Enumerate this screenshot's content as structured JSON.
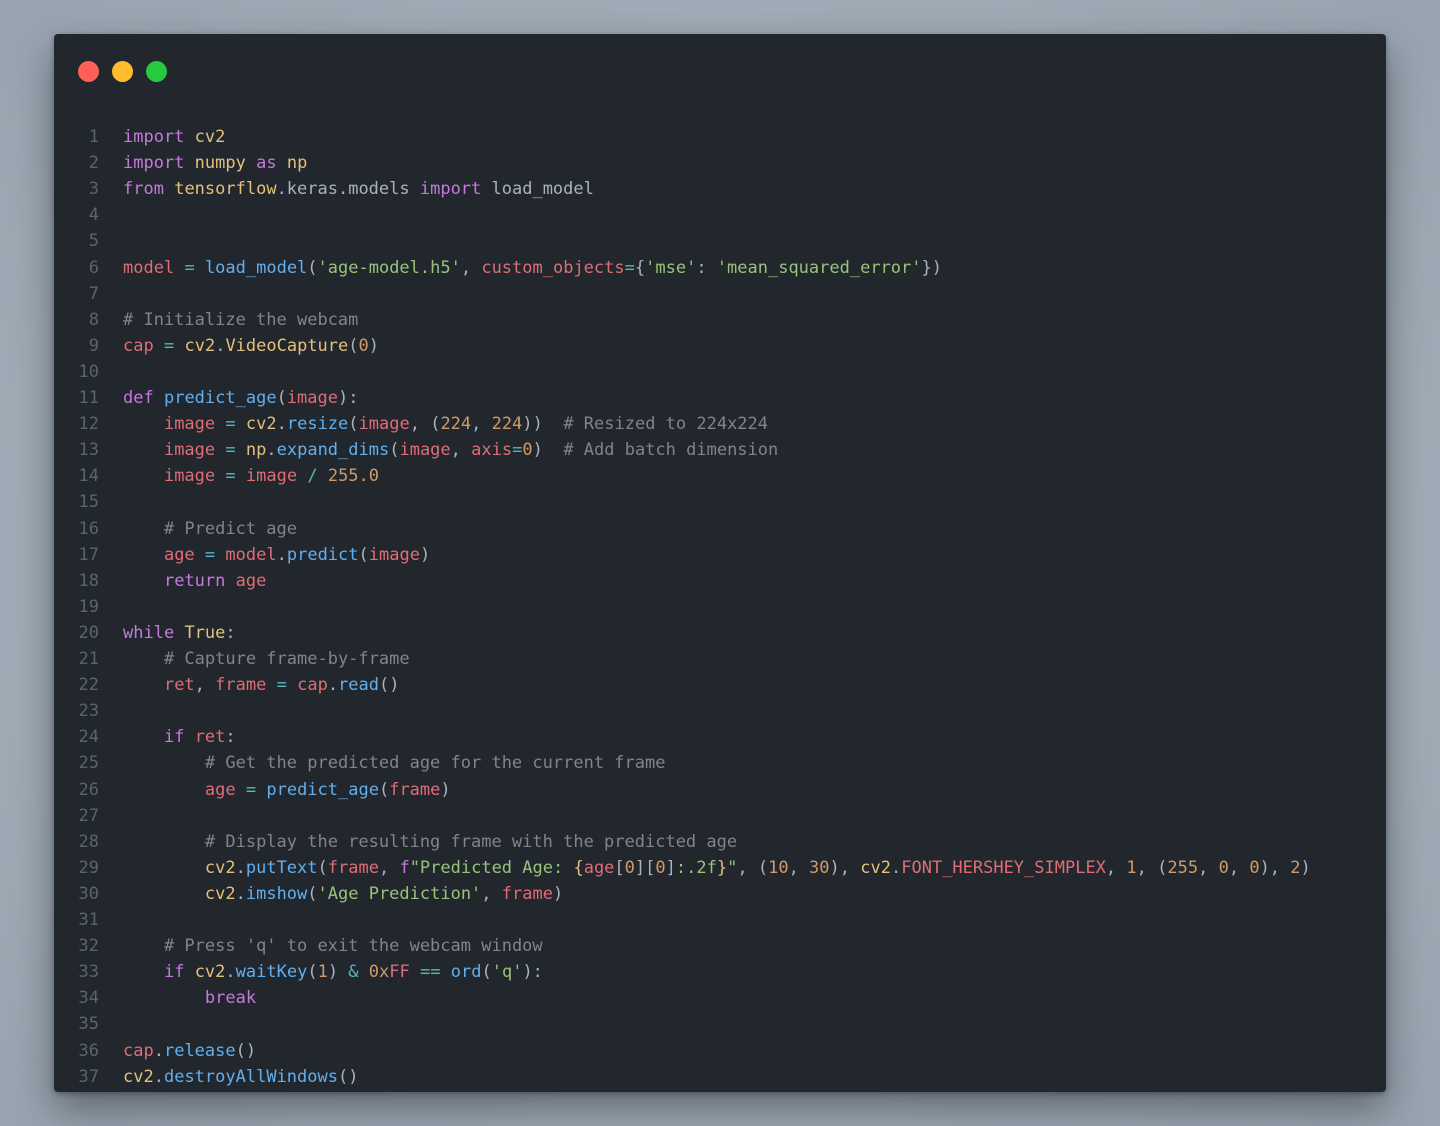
{
  "window": {
    "controls": [
      {
        "name": "close",
        "color": "#ff5f56"
      },
      {
        "name": "minimize",
        "color": "#ffbd2e"
      },
      {
        "name": "maximize",
        "color": "#27c93f"
      }
    ]
  },
  "code": {
    "language": "python",
    "lines": [
      [
        [
          "kw",
          "import"
        ],
        [
          "pl",
          " "
        ],
        [
          "mod",
          "cv2"
        ]
      ],
      [
        [
          "kw",
          "import"
        ],
        [
          "pl",
          " "
        ],
        [
          "mod",
          "numpy"
        ],
        [
          "pl",
          " "
        ],
        [
          "kw",
          "as"
        ],
        [
          "pl",
          " "
        ],
        [
          "mod",
          "np"
        ]
      ],
      [
        [
          "kw",
          "from"
        ],
        [
          "pl",
          " "
        ],
        [
          "mod",
          "tensorflow"
        ],
        [
          "pl",
          ".keras.models "
        ],
        [
          "kw",
          "import"
        ],
        [
          "pl",
          " load_model"
        ]
      ],
      [],
      [],
      [
        [
          "var",
          "model"
        ],
        [
          "pl",
          " "
        ],
        [
          "op",
          "="
        ],
        [
          "pl",
          " "
        ],
        [
          "fn",
          "load_model"
        ],
        [
          "pl",
          "("
        ],
        [
          "str",
          "'age-model.h5'"
        ],
        [
          "pl",
          ", "
        ],
        [
          "var",
          "custom_objects"
        ],
        [
          "op",
          "="
        ],
        [
          "pl",
          "{"
        ],
        [
          "str",
          "'mse'"
        ],
        [
          "pl",
          ": "
        ],
        [
          "str",
          "'mean_squared_error'"
        ],
        [
          "pl",
          "})"
        ]
      ],
      [],
      [
        [
          "cm",
          "# Initialize the webcam"
        ]
      ],
      [
        [
          "var",
          "cap"
        ],
        [
          "pl",
          " "
        ],
        [
          "op",
          "="
        ],
        [
          "pl",
          " "
        ],
        [
          "mod",
          "cv2"
        ],
        [
          "pl",
          "."
        ],
        [
          "mod",
          "VideoCapture"
        ],
        [
          "pl",
          "("
        ],
        [
          "num",
          "0"
        ],
        [
          "pl",
          ")"
        ]
      ],
      [],
      [
        [
          "kw",
          "def"
        ],
        [
          "pl",
          " "
        ],
        [
          "fn",
          "predict_age"
        ],
        [
          "pl",
          "("
        ],
        [
          "var",
          "image"
        ],
        [
          "pl",
          "):"
        ]
      ],
      [
        [
          "pl",
          "    "
        ],
        [
          "var",
          "image"
        ],
        [
          "pl",
          " "
        ],
        [
          "op",
          "="
        ],
        [
          "pl",
          " "
        ],
        [
          "mod",
          "cv2"
        ],
        [
          "pl",
          "."
        ],
        [
          "fn",
          "resize"
        ],
        [
          "pl",
          "("
        ],
        [
          "var",
          "image"
        ],
        [
          "pl",
          ", ("
        ],
        [
          "num",
          "224"
        ],
        [
          "pl",
          ", "
        ],
        [
          "num",
          "224"
        ],
        [
          "pl",
          "))  "
        ],
        [
          "cm",
          "# Resized to 224x224"
        ]
      ],
      [
        [
          "pl",
          "    "
        ],
        [
          "var",
          "image"
        ],
        [
          "pl",
          " "
        ],
        [
          "op",
          "="
        ],
        [
          "pl",
          " "
        ],
        [
          "mod",
          "np"
        ],
        [
          "pl",
          "."
        ],
        [
          "fn",
          "expand_dims"
        ],
        [
          "pl",
          "("
        ],
        [
          "var",
          "image"
        ],
        [
          "pl",
          ", "
        ],
        [
          "var",
          "axis"
        ],
        [
          "op",
          "="
        ],
        [
          "num",
          "0"
        ],
        [
          "pl",
          ")  "
        ],
        [
          "cm",
          "# Add batch dimension"
        ]
      ],
      [
        [
          "pl",
          "    "
        ],
        [
          "var",
          "image"
        ],
        [
          "pl",
          " "
        ],
        [
          "op",
          "="
        ],
        [
          "pl",
          " "
        ],
        [
          "var",
          "image"
        ],
        [
          "pl",
          " "
        ],
        [
          "op",
          "/"
        ],
        [
          "pl",
          " "
        ],
        [
          "num",
          "255.0"
        ]
      ],
      [],
      [
        [
          "pl",
          "    "
        ],
        [
          "cm",
          "# Predict age"
        ]
      ],
      [
        [
          "pl",
          "    "
        ],
        [
          "var",
          "age"
        ],
        [
          "pl",
          " "
        ],
        [
          "op",
          "="
        ],
        [
          "pl",
          " "
        ],
        [
          "var",
          "model"
        ],
        [
          "pl",
          "."
        ],
        [
          "fn",
          "predict"
        ],
        [
          "pl",
          "("
        ],
        [
          "var",
          "image"
        ],
        [
          "pl",
          ")"
        ]
      ],
      [
        [
          "pl",
          "    "
        ],
        [
          "kw",
          "return"
        ],
        [
          "pl",
          " "
        ],
        [
          "var",
          "age"
        ]
      ],
      [],
      [
        [
          "kw",
          "while"
        ],
        [
          "pl",
          " "
        ],
        [
          "mod",
          "True"
        ],
        [
          "pl",
          ":"
        ]
      ],
      [
        [
          "pl",
          "    "
        ],
        [
          "cm",
          "# Capture frame-by-frame"
        ]
      ],
      [
        [
          "pl",
          "    "
        ],
        [
          "var",
          "ret"
        ],
        [
          "pl",
          ", "
        ],
        [
          "var",
          "frame"
        ],
        [
          "pl",
          " "
        ],
        [
          "op",
          "="
        ],
        [
          "pl",
          " "
        ],
        [
          "var",
          "cap"
        ],
        [
          "pl",
          "."
        ],
        [
          "fn",
          "read"
        ],
        [
          "pl",
          "()"
        ]
      ],
      [],
      [
        [
          "pl",
          "    "
        ],
        [
          "kw",
          "if"
        ],
        [
          "pl",
          " "
        ],
        [
          "var",
          "ret"
        ],
        [
          "pl",
          ":"
        ]
      ],
      [
        [
          "pl",
          "        "
        ],
        [
          "cm",
          "# Get the predicted age for the current frame"
        ]
      ],
      [
        [
          "pl",
          "        "
        ],
        [
          "var",
          "age"
        ],
        [
          "pl",
          " "
        ],
        [
          "op",
          "="
        ],
        [
          "pl",
          " "
        ],
        [
          "fn",
          "predict_age"
        ],
        [
          "pl",
          "("
        ],
        [
          "var",
          "frame"
        ],
        [
          "pl",
          ")"
        ]
      ],
      [],
      [
        [
          "pl",
          "        "
        ],
        [
          "cm",
          "# Display the resulting frame with the predicted age"
        ]
      ],
      [
        [
          "pl",
          "        "
        ],
        [
          "mod",
          "cv2"
        ],
        [
          "pl",
          "."
        ],
        [
          "fn",
          "putText"
        ],
        [
          "pl",
          "("
        ],
        [
          "var",
          "frame"
        ],
        [
          "pl",
          ", "
        ],
        [
          "kw",
          "f"
        ],
        [
          "str",
          "\"Predicted Age: "
        ],
        [
          "mod",
          "{"
        ],
        [
          "var",
          "age"
        ],
        [
          "pl",
          "["
        ],
        [
          "num",
          "0"
        ],
        [
          "pl",
          "]["
        ],
        [
          "num",
          "0"
        ],
        [
          "pl",
          "]"
        ],
        [
          "str",
          ":.2f"
        ],
        [
          "mod",
          "}"
        ],
        [
          "str",
          "\""
        ],
        [
          "pl",
          ", ("
        ],
        [
          "num",
          "10"
        ],
        [
          "pl",
          ", "
        ],
        [
          "num",
          "30"
        ],
        [
          "pl",
          "), "
        ],
        [
          "mod",
          "cv2"
        ],
        [
          "pl",
          "."
        ],
        [
          "var",
          "FONT_HERSHEY_SIMPLEX"
        ],
        [
          "pl",
          ", "
        ],
        [
          "num",
          "1"
        ],
        [
          "pl",
          ", ("
        ],
        [
          "num",
          "255"
        ],
        [
          "pl",
          ", "
        ],
        [
          "num",
          "0"
        ],
        [
          "pl",
          ", "
        ],
        [
          "num",
          "0"
        ],
        [
          "pl",
          "), "
        ],
        [
          "num",
          "2"
        ],
        [
          "pl",
          ")"
        ]
      ],
      [
        [
          "pl",
          "        "
        ],
        [
          "mod",
          "cv2"
        ],
        [
          "pl",
          "."
        ],
        [
          "fn",
          "imshow"
        ],
        [
          "pl",
          "("
        ],
        [
          "str",
          "'Age Prediction'"
        ],
        [
          "pl",
          ", "
        ],
        [
          "var",
          "frame"
        ],
        [
          "pl",
          ")"
        ]
      ],
      [],
      [
        [
          "pl",
          "    "
        ],
        [
          "cm",
          "# Press 'q' to exit the webcam window"
        ]
      ],
      [
        [
          "pl",
          "    "
        ],
        [
          "kw",
          "if"
        ],
        [
          "pl",
          " "
        ],
        [
          "mod",
          "cv2"
        ],
        [
          "pl",
          "."
        ],
        [
          "fn",
          "waitKey"
        ],
        [
          "pl",
          "("
        ],
        [
          "num",
          "1"
        ],
        [
          "pl",
          ") "
        ],
        [
          "op",
          "&"
        ],
        [
          "pl",
          " "
        ],
        [
          "num",
          "0x"
        ],
        [
          "var",
          "FF"
        ],
        [
          "pl",
          " "
        ],
        [
          "op",
          "=="
        ],
        [
          "pl",
          " "
        ],
        [
          "fn",
          "ord"
        ],
        [
          "pl",
          "("
        ],
        [
          "str",
          "'q'"
        ],
        [
          "pl",
          "):"
        ]
      ],
      [
        [
          "pl",
          "        "
        ],
        [
          "kw",
          "break"
        ]
      ],
      [],
      [
        [
          "var",
          "cap"
        ],
        [
          "pl",
          "."
        ],
        [
          "fn",
          "release"
        ],
        [
          "pl",
          "()"
        ]
      ],
      [
        [
          "mod",
          "cv2"
        ],
        [
          "pl",
          "."
        ],
        [
          "fn",
          "destroyAllWindows"
        ],
        [
          "pl",
          "()"
        ]
      ]
    ]
  }
}
